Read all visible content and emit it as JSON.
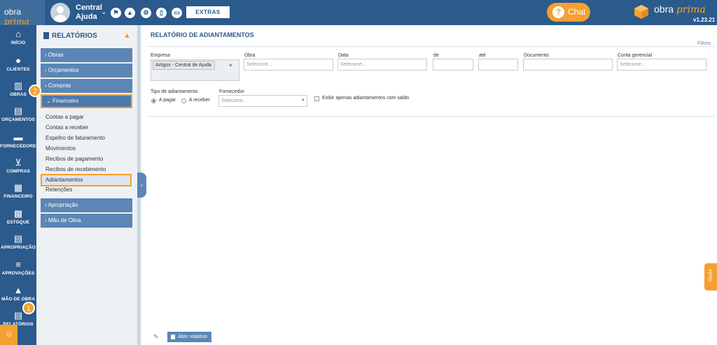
{
  "topbar": {
    "logo_prefix": "obra",
    "logo_suffix": "prima",
    "user_name": "Central Ajuda",
    "icons": [
      "chevron-down-icon",
      "flag-icon",
      "graduation-icon",
      "gear-icon",
      "tablet-icon",
      "monitor-icon"
    ],
    "extras_label": "EXTRAS",
    "chat_label": "Chat",
    "brand_prefix": "obra",
    "brand_suffix": "prima",
    "version": "v1.23.21"
  },
  "nav": {
    "items": [
      {
        "label": "INÍCIO",
        "icon": "home-icon"
      },
      {
        "label": "CLIENTES",
        "icon": "user-icon"
      },
      {
        "label": "OBRAS",
        "icon": "building-icon"
      },
      {
        "label": "ORÇAMENTOS",
        "icon": "document-icon"
      },
      {
        "label": "FORNECEDORES",
        "icon": "truck-icon"
      },
      {
        "label": "COMPRAS",
        "icon": "cart-icon"
      },
      {
        "label": "FINANCEIRO",
        "icon": "calculator-icon"
      },
      {
        "label": "ESTOQUE",
        "icon": "boxes-icon"
      },
      {
        "label": "APROPRIAÇÃO",
        "icon": "file-icon"
      },
      {
        "label": "APROVAÇÕES",
        "icon": "list-check-icon"
      },
      {
        "label": "MÃO DE OBRA",
        "icon": "workers-icon"
      },
      {
        "label": "RELATÓRIOS",
        "icon": "report-icon"
      }
    ],
    "step_badges": [
      "1",
      "2"
    ]
  },
  "sidebar": {
    "title": "RELATÓRIOS",
    "sections": [
      {
        "label": "› Obras"
      },
      {
        "label": "› Orçamentos"
      },
      {
        "label": "› Compras"
      },
      {
        "label": "⌄ Financeiro"
      }
    ],
    "financeiro_links": [
      "Contas a pagar",
      "Contas a receber",
      "Espelho de faturamento",
      "Movimentos",
      "Recibos de pagamento",
      "Recibos de recebimento",
      "Adiantamentos",
      "Retenções"
    ],
    "lower_sections": [
      {
        "label": "› Apropriação"
      },
      {
        "label": "› Mão de Obra"
      }
    ]
  },
  "main": {
    "title": "RELATÓRIO DE ADIANTAMENTOS",
    "filters_link": "Filtros",
    "fields": {
      "empresa_label": "Empresa",
      "empresa_tag": "Artigos - Central de Ajuda",
      "empresa_tag_remove": "×",
      "obra_label": "Obra",
      "obra_placeholder": "Selecione...",
      "data_label": "Data",
      "data_placeholder": "Selecione...",
      "de_label": "de",
      "ate_label": "até",
      "documento_label": "Documento",
      "conta_label": "Conta gerencial",
      "conta_placeholder": "Selecione...",
      "tipo_label": "Tipo de adiantamento",
      "tipo_options": [
        "A pagar",
        "A receber"
      ],
      "tipo_selected": "A pagar",
      "fornecedor_label": "Fornecedor",
      "fornecedor_placeholder": "Selecione...",
      "saldo_label": "Exibir apenas adiantamentos com saldo"
    },
    "report_button": "Abrir relatório",
    "help_tab": "Ajuda"
  }
}
